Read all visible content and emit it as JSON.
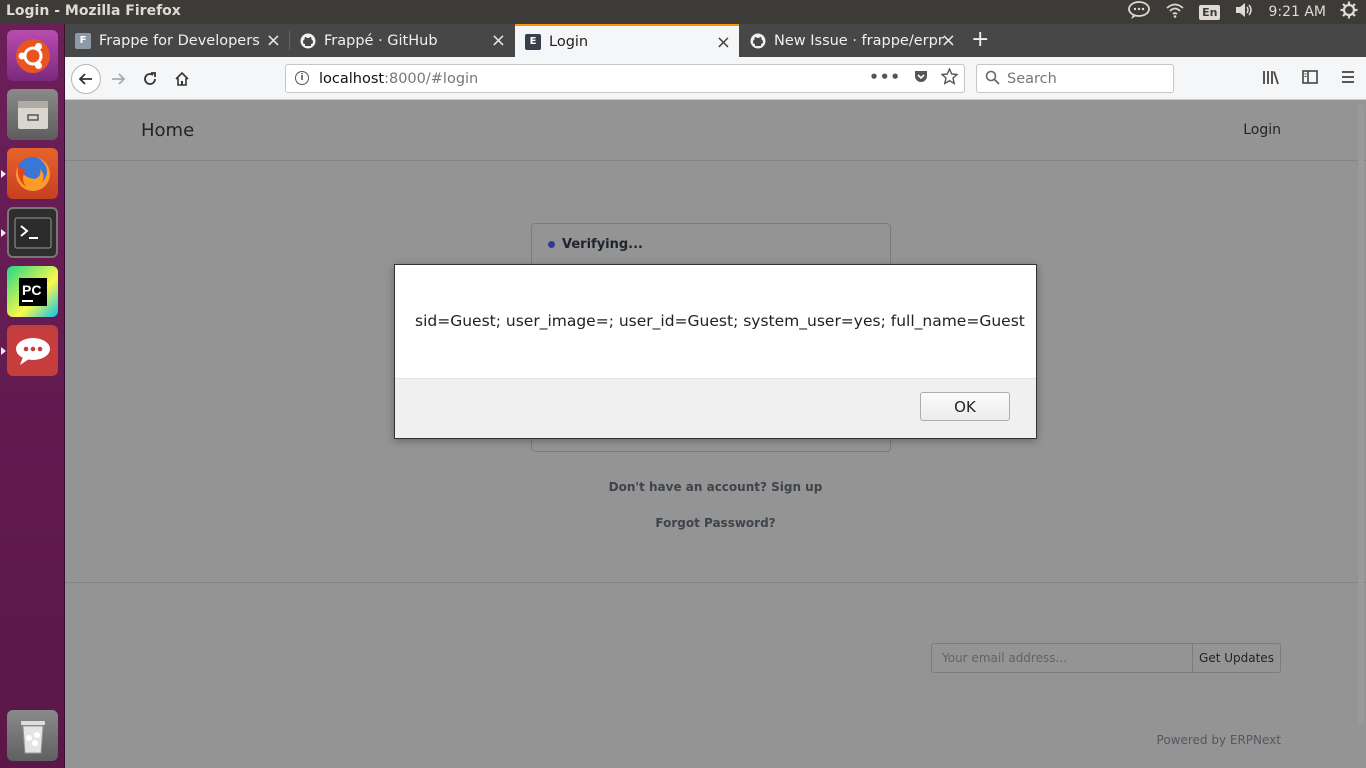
{
  "system": {
    "window_title": "Login - Mozilla Firefox",
    "lang": "En",
    "time": "9:21 AM"
  },
  "browser": {
    "tabs": [
      {
        "label": "Frappe for Developers",
        "fav": "F"
      },
      {
        "label": "Frappé · GitHub",
        "fav": "github"
      },
      {
        "label": "Login",
        "fav": "E"
      },
      {
        "label": "New Issue · frappe/erpn",
        "fav": "github"
      }
    ],
    "url_host": "localhost",
    "url_path": ":8000/#login",
    "search_placeholder": "Search"
  },
  "page": {
    "nav_home": "Home",
    "nav_login": "Login",
    "verifying": "Verifying...",
    "signup": "Don't have an account? Sign up",
    "forgot": "Forgot Password?",
    "email_placeholder": "Your email address...",
    "get_updates": "Get Updates",
    "powered_by": "Powered by ERPNext"
  },
  "dialog": {
    "message": "sid=Guest; user_image=; user_id=Guest; system_user=yes; full_name=Guest",
    "ok_label": "OK"
  },
  "colors": {
    "launcher": "#5e1a4c",
    "active_tab_accent": "#ff9500",
    "verify_dot": "#5e64ff"
  }
}
